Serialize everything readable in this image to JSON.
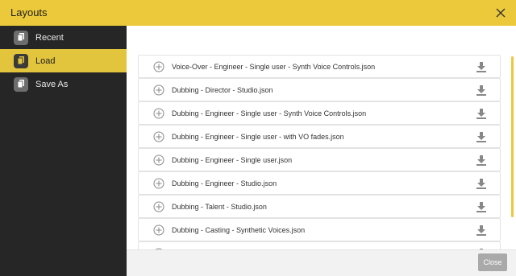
{
  "dialog": {
    "title": "Layouts",
    "close_icon": "close-icon"
  },
  "sidebar": {
    "items": [
      {
        "label": "Recent",
        "icon": "copy-icon",
        "active": false
      },
      {
        "label": "Load",
        "icon": "copy-icon",
        "active": true
      },
      {
        "label": "Save As",
        "icon": "copy-icon",
        "active": false
      }
    ]
  },
  "files": [
    {
      "name": "Voice-Over - Engineer - Single user - Synth Voice Controls.json"
    },
    {
      "name": "Dubbing - Director - Studio.json"
    },
    {
      "name": "Dubbing - Engineer - Single user - Synth Voice Controls.json"
    },
    {
      "name": "Dubbing - Engineer - Single user - with VO fades.json"
    },
    {
      "name": "Dubbing - Engineer - Single user.json"
    },
    {
      "name": "Dubbing - Engineer - Studio.json"
    },
    {
      "name": "Dubbing - Talent - Studio.json"
    },
    {
      "name": "Dubbing - Casting - Synthetic Voices.json"
    }
  ],
  "footer": {
    "close_label": "Close"
  },
  "colors": {
    "accent": "#ecc93a",
    "sidebar_bg": "#262626"
  }
}
